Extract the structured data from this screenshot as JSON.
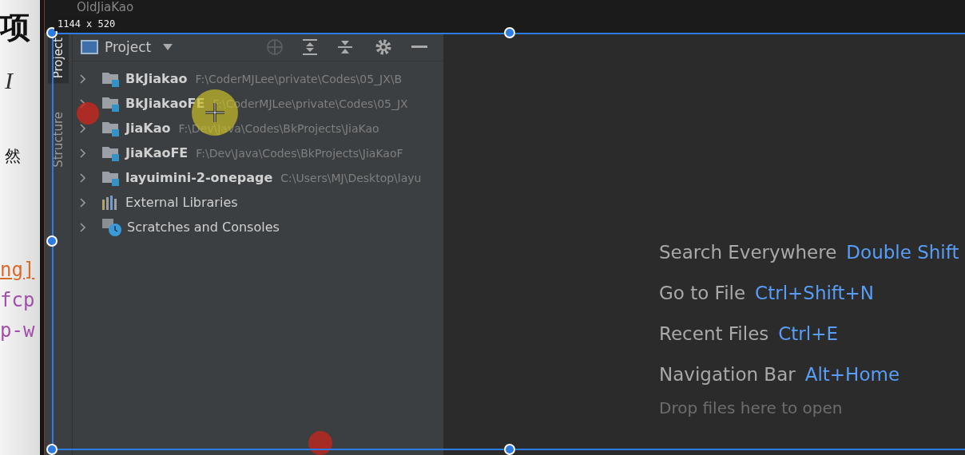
{
  "background_doc": {
    "heading": "项",
    "italic_button": "I",
    "paragraph": "然",
    "code_lines": [
      "ng]",
      "fcp",
      "p-w"
    ]
  },
  "title_bar": {
    "text": "OldJiaKao"
  },
  "selection": {
    "size_label": "1144 x 520"
  },
  "side_tabs": [
    {
      "label": "Project",
      "selected": true
    },
    {
      "label": "Structure",
      "selected": false
    }
  ],
  "project_panel": {
    "title": "Project",
    "tree": [
      {
        "kind": "module",
        "name": "BkJiakao",
        "path": "F:\\CoderMJLee\\private\\Codes\\05_JX\\B",
        "expanded": false
      },
      {
        "kind": "module",
        "name": "BkJiakaoFE",
        "path": "F:\\CoderMJLee\\private\\Codes\\05_JX",
        "expanded": false
      },
      {
        "kind": "module",
        "name": "JiaKao",
        "path": "F:\\Dev\\Java\\Codes\\BkProjects\\JiaKao",
        "expanded": false
      },
      {
        "kind": "module",
        "name": "JiaKaoFE",
        "path": "F:\\Dev\\Java\\Codes\\BkProjects\\JiaKaoF",
        "expanded": false
      },
      {
        "kind": "module",
        "name": "layuimini-2-onepage",
        "path": "C:\\Users\\MJ\\Desktop\\layu",
        "expanded": false
      },
      {
        "kind": "library",
        "name": "External Libraries",
        "expanded": false
      },
      {
        "kind": "scratches",
        "name": "Scratches and Consoles",
        "expanded": false
      }
    ]
  },
  "welcome": {
    "shortcuts": [
      {
        "action": "Search Everywhere",
        "keys": "Double Shift"
      },
      {
        "action": "Go to File",
        "keys": "Ctrl+Shift+N"
      },
      {
        "action": "Recent Files",
        "keys": "Ctrl+E"
      },
      {
        "action": "Navigation Bar",
        "keys": "Alt+Home"
      }
    ],
    "hint": "Drop files here to open"
  }
}
